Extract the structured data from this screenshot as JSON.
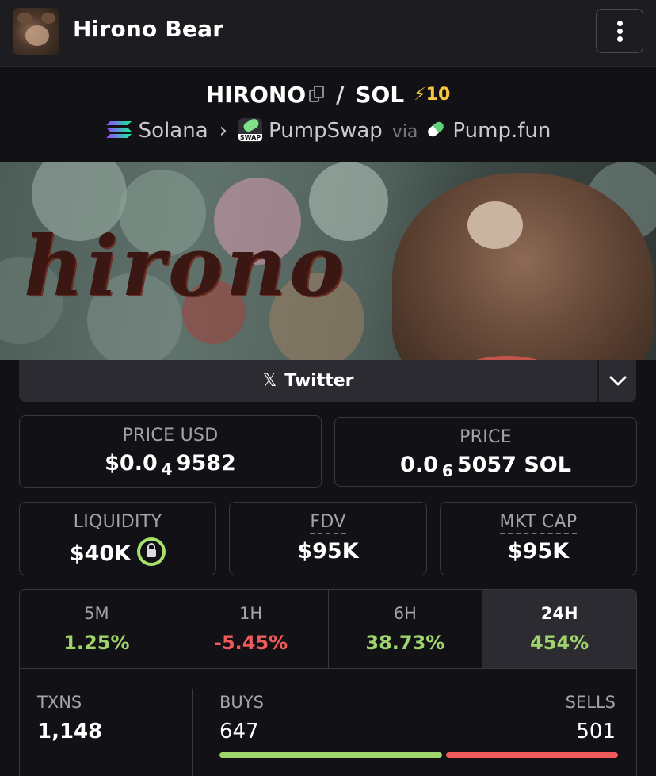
{
  "header": {
    "title": "Hirono Bear"
  },
  "pair": {
    "base": "HIRONO",
    "quote": "SOL",
    "separator": "/",
    "boost_icon": "⚡",
    "boost_count": "10",
    "chain": "Solana",
    "dex": "PumpSwap",
    "via_label": "via",
    "launchpad": "Pump.fun"
  },
  "banner": {
    "text": "hirono"
  },
  "links": {
    "twitter_label": "Twitter",
    "twitter_icon": "𝕏"
  },
  "stats": {
    "price_usd": {
      "label": "PRICE USD",
      "prefix": "$0.0",
      "zeros": "4",
      "digits": "9582"
    },
    "price_native": {
      "label": "PRICE",
      "prefix": "0.0",
      "zeros": "6",
      "digits": "5057 SOL"
    },
    "liquidity": {
      "label": "LIQUIDITY",
      "value": "$40K"
    },
    "fdv": {
      "label": "FDV",
      "value": "$95K"
    },
    "mkt_cap": {
      "label": "MKT CAP",
      "value": "$95K"
    }
  },
  "timeframes": [
    {
      "label": "5M",
      "change": "1.25%",
      "direction": "up"
    },
    {
      "label": "1H",
      "change": "-5.45%",
      "direction": "down"
    },
    {
      "label": "6H",
      "change": "38.73%",
      "direction": "up"
    },
    {
      "label": "24H",
      "change": "454%",
      "direction": "up",
      "selected": true
    }
  ],
  "txns": {
    "label": "TXNS",
    "total": "1,148",
    "buys_label": "BUYS",
    "buys": "647",
    "sells_label": "SELLS",
    "sells": "501"
  },
  "colors": {
    "positive": "#9fd36b",
    "negative": "#f05a5a",
    "boost": "#f6c643",
    "panel": "#2b2b31"
  }
}
